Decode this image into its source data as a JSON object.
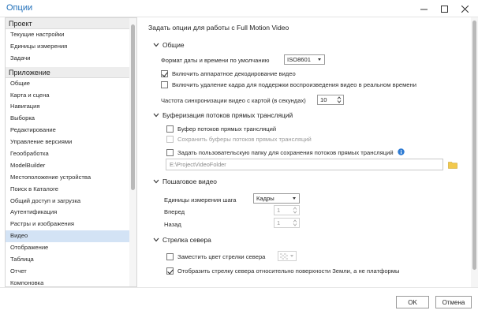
{
  "window": {
    "title": "Опции"
  },
  "nav": {
    "groups": [
      {
        "label": "Проект",
        "items": [
          "Текущие настройки",
          "Единицы измерения",
          "Задачи"
        ]
      },
      {
        "label": "Приложение",
        "items": [
          "Общие",
          "Карта и сцена",
          "Навигация",
          "Выборка",
          "Редактирование",
          "Управление версиями",
          "Геообработка",
          "ModelBuilder",
          "Местоположение устройства",
          "Поиск в Каталоге",
          "Общий доступ и загрузка",
          "Аутентификация",
          "Растры и изображения",
          "Видео",
          "Отображение",
          "Таблица",
          "Отчет",
          "Компоновка"
        ]
      }
    ],
    "selected": "Видео"
  },
  "content": {
    "header": "Задать опции для работы с Full Motion Video",
    "general": {
      "title": "Общие",
      "date_format_label": "Формат даты и времени по умолчанию",
      "date_format_value": "ISO8601",
      "hw_decode_label": "Включить аппаратное декодирование видео",
      "hw_decode_checked": true,
      "frame_drop_label": "Включить удаление кадра для поддержки воспроизведения видео в реальном времени",
      "frame_drop_checked": false,
      "sync_label": "Частота синхронизации видео с картой (в секундах)",
      "sync_value": "10"
    },
    "buffering": {
      "title": "Буферизация потоков прямых трансляций",
      "buffer_label": "Буфер потоков прямых трансляций",
      "save_buffer_label": "Сохранить буферы потоков прямых трансляций",
      "custom_folder_label": "Задать пользовательскую папку для сохранения потоков прямых трансляций",
      "folder_path": "E:\\ProjectVideoFolder"
    },
    "stepping": {
      "title": "Пошаговое видео",
      "unit_label": "Единицы измерения шага",
      "unit_value": "Кадры",
      "forward_label": "Вперед",
      "forward_value": "1",
      "back_label": "Назад",
      "back_value": "1"
    },
    "north_arrow": {
      "title": "Стрелка севера",
      "replace_color_label": "Заместить цвет стрелки севера",
      "replace_color_checked": false,
      "relative_label": "Отобразить стрелку севера относительно поверхности Земли, а не платформы",
      "relative_checked": true
    }
  },
  "footer": {
    "ok_label": "OK",
    "cancel_label": "Отмена"
  }
}
